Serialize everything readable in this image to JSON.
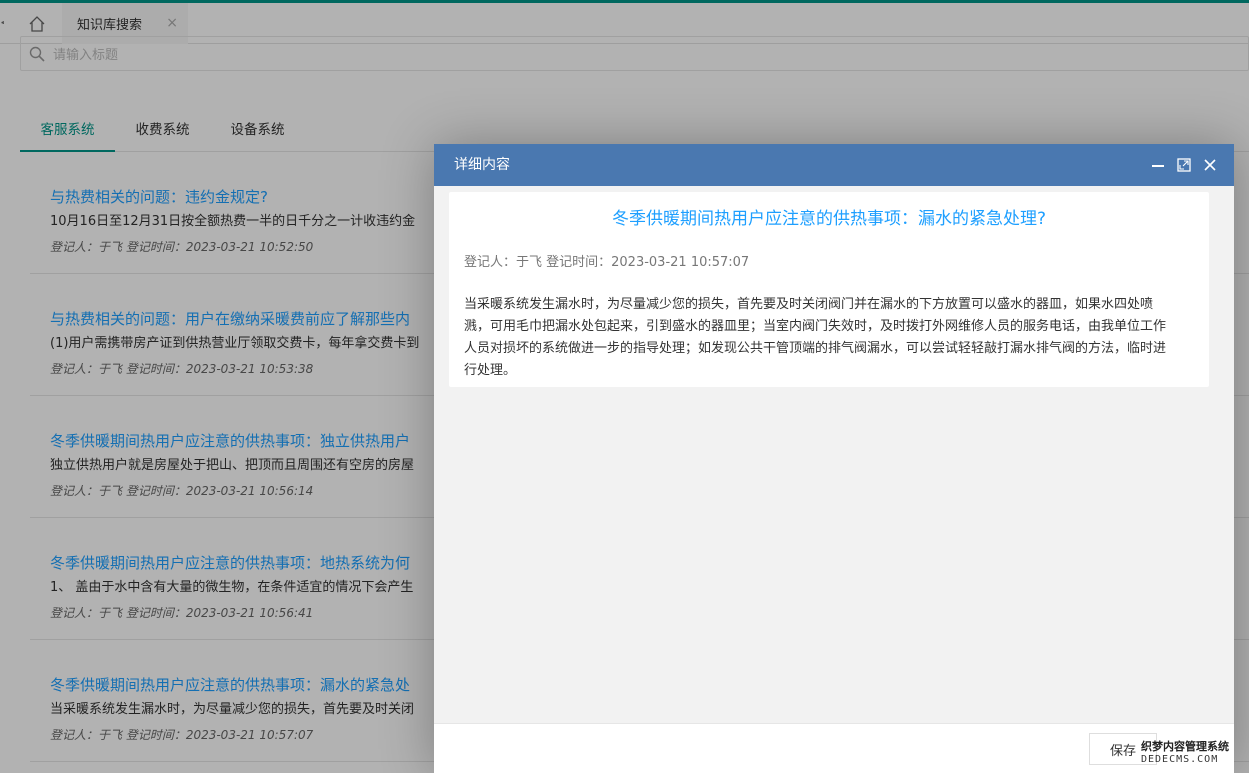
{
  "tabbar": {
    "edge_glyph": "<",
    "page_tab_label": "知识库搜索",
    "close_glyph": "×"
  },
  "search": {
    "placeholder": "请输入标题"
  },
  "tabs": [
    {
      "label": "客服系统",
      "active": true
    },
    {
      "label": "收费系统",
      "active": false
    },
    {
      "label": "设备系统",
      "active": false
    }
  ],
  "items": [
    {
      "title": "与热费相关的问题：违约金规定?",
      "body": "10月16日至12月31日按全额热费一半的日千分之一计收违约金",
      "meta": "登记人：于飞   登记时间：2023-03-21 10:52:50"
    },
    {
      "title": "与热费相关的问题：用户在缴纳采暖费前应了解那些内",
      "body": "(1)用户需携带房产证到供热营业厅领取交费卡，每年拿交费卡到",
      "meta": "登记人：于飞   登记时间：2023-03-21 10:53:38"
    },
    {
      "title": "冬季供暖期间热用户应注意的供热事项：独立供热用户",
      "body": "独立供热用户就是房屋处于把山、把顶而且周围还有空房的房屋",
      "meta": "登记人：于飞   登记时间：2023-03-21 10:56:14"
    },
    {
      "title": "冬季供暖期间热用户应注意的供热事项：地热系统为何",
      "body": "1、 盖由于水中含有大量的微生物，在条件适宜的情况下会产生",
      "meta": "登记人：于飞   登记时间：2023-03-21 10:56:41"
    },
    {
      "title": "冬季供暖期间热用户应注意的供热事项：漏水的紧急处",
      "body": "当采暖系统发生漏水时，为尽量减少您的损失，首先要及时关闭",
      "meta": "登记人：于飞   登记时间：2023-03-21 10:57:07"
    }
  ],
  "modal": {
    "title": "详细内容",
    "article_title": "冬季供暖期间热用户应注意的供热事项：漏水的紧急处理?",
    "article_meta": "登记人：于飞 登记时间：2023-03-21 10:57:07",
    "article_text": "当采暖系统发生漏水时，为尽量减少您的损失，首先要及时关闭阀门并在漏水的下方放置可以盛水的器皿，如果水四处喷溅，可用毛巾把漏水处包起来，引到盛水的器皿里；当室内阀门失效时，及时拨打外网维修人员的服务电话，由我单位工作人员对损坏的系统做进一步的指导处理；如发现公共干管顶端的排气阀漏水，可以尝试轻轻敲打漏水排气阀的方法，临时进行处理。",
    "save_label": "保存"
  },
  "watermark": {
    "line1": "织梦内容管理系统",
    "line2": "DEDECMS.COM"
  },
  "colors": {
    "accent": "#009688",
    "link": "#1e9fff",
    "modal_header": "#4a78b0"
  }
}
